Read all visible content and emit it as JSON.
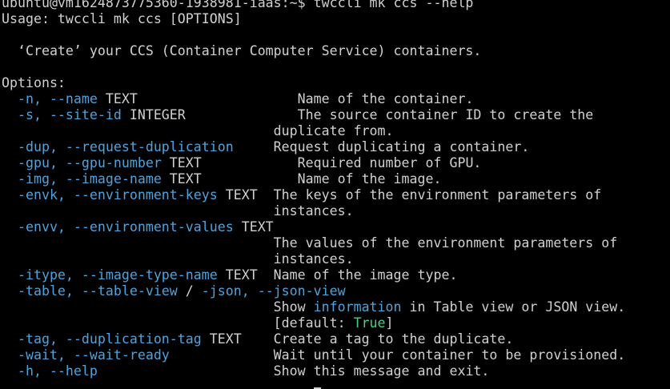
{
  "theme": {
    "background": "#000000",
    "text": "#d0d0d0",
    "flag": "#4da3dd",
    "value": "#3fd48a"
  },
  "terminal": {
    "lines": [
      {
        "segments": [
          {
            "t": "ubuntu@vm1624873775360-1938981-iaas:~$ twccli mk ccs --help",
            "c": "white"
          }
        ]
      },
      {
        "segments": [
          {
            "t": "Usage: twccli mk ccs [OPTIONS]",
            "c": "white"
          }
        ]
      },
      {
        "segments": [
          {
            "t": "",
            "c": "white"
          }
        ]
      },
      {
        "segments": [
          {
            "t": "  ‘Create’ your CCS (Container Computer Service) containers.",
            "c": "white"
          }
        ]
      },
      {
        "segments": [
          {
            "t": "",
            "c": "white"
          }
        ]
      },
      {
        "segments": [
          {
            "t": "Options:",
            "c": "white"
          }
        ]
      },
      {
        "segments": [
          {
            "t": "  -n, --name",
            "c": "flag"
          },
          {
            "t": " TEXT                    Name of the container.",
            "c": "white"
          }
        ]
      },
      {
        "segments": [
          {
            "t": "  -s, --site-id",
            "c": "flag"
          },
          {
            "t": " INTEGER              The source container ID to create the",
            "c": "white"
          }
        ]
      },
      {
        "segments": [
          {
            "t": "                                  duplicate from.",
            "c": "white"
          }
        ]
      },
      {
        "segments": [
          {
            "t": "  -dup, --request-duplication",
            "c": "flag"
          },
          {
            "t": "     Request duplicating a container.",
            "c": "white"
          }
        ]
      },
      {
        "segments": [
          {
            "t": "  -gpu, --gpu-number",
            "c": "flag"
          },
          {
            "t": " TEXT            Required number of GPU.",
            "c": "white"
          }
        ]
      },
      {
        "segments": [
          {
            "t": "  -img, --image-name",
            "c": "flag"
          },
          {
            "t": " TEXT            Name of the image.",
            "c": "white"
          }
        ]
      },
      {
        "segments": [
          {
            "t": "  -envk, --environment-keys",
            "c": "flag"
          },
          {
            "t": " TEXT  The keys of the environment parameters of",
            "c": "white"
          }
        ]
      },
      {
        "segments": [
          {
            "t": "                                  instances.",
            "c": "white"
          }
        ]
      },
      {
        "segments": [
          {
            "t": "  -envv, --environment-values",
            "c": "flag"
          },
          {
            "t": " TEXT",
            "c": "white"
          }
        ]
      },
      {
        "segments": [
          {
            "t": "                                  The values of the environment parameters of",
            "c": "white"
          }
        ]
      },
      {
        "segments": [
          {
            "t": "                                  instances.",
            "c": "white"
          }
        ]
      },
      {
        "segments": [
          {
            "t": "  -itype, --image-type-name",
            "c": "flag"
          },
          {
            "t": " TEXT  Name of the image type.",
            "c": "white"
          }
        ]
      },
      {
        "segments": [
          {
            "t": "  -table, --table-view",
            "c": "flag"
          },
          {
            "t": " / ",
            "c": "white"
          },
          {
            "t": "-json, --json-view",
            "c": "flag"
          }
        ]
      },
      {
        "segments": [
          {
            "t": "                                  Show ",
            "c": "white"
          },
          {
            "t": "information",
            "c": "flag"
          },
          {
            "t": " in Table view or JSON view.",
            "c": "white"
          }
        ]
      },
      {
        "segments": [
          {
            "t": "                                  [default: ",
            "c": "white"
          },
          {
            "t": "True",
            "c": "green"
          },
          {
            "t": "]",
            "c": "white"
          }
        ]
      },
      {
        "segments": [
          {
            "t": "  -tag, --duplication-tag",
            "c": "flag"
          },
          {
            "t": " TEXT    Create a tag to the duplicate.",
            "c": "white"
          }
        ]
      },
      {
        "segments": [
          {
            "t": "  -wait, --wait-ready",
            "c": "flag"
          },
          {
            "t": "             Wait until your container to be provisioned.",
            "c": "white"
          }
        ]
      },
      {
        "segments": [
          {
            "t": "  -h, --help",
            "c": "flag"
          },
          {
            "t": "                      Show this message and exit.",
            "c": "white"
          }
        ]
      }
    ]
  }
}
